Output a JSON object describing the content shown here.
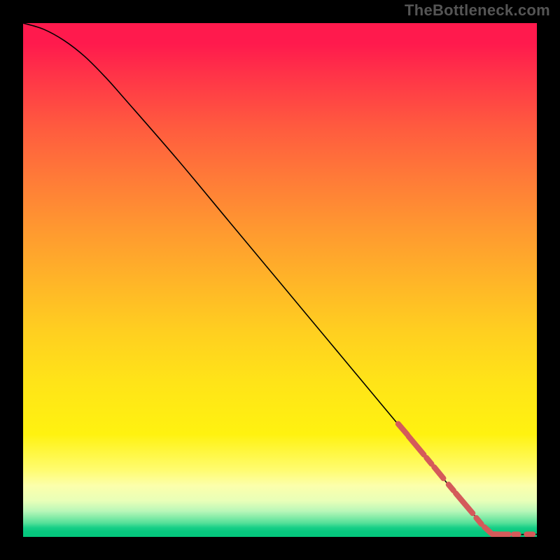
{
  "watermark": "TheBottleneck.com",
  "chart_data": {
    "type": "line",
    "title": "",
    "xlabel": "",
    "ylabel": "",
    "xlim": [
      0,
      100
    ],
    "ylim": [
      0,
      100
    ],
    "curve": {
      "name": "bottleneck-curve",
      "points": [
        {
          "x": 0,
          "y": 100
        },
        {
          "x": 4,
          "y": 98.8
        },
        {
          "x": 8,
          "y": 96.6
        },
        {
          "x": 12,
          "y": 93.5
        },
        {
          "x": 16,
          "y": 89.5
        },
        {
          "x": 20,
          "y": 85.0
        },
        {
          "x": 30,
          "y": 73.5
        },
        {
          "x": 40,
          "y": 61.5
        },
        {
          "x": 50,
          "y": 49.5
        },
        {
          "x": 60,
          "y": 37.5
        },
        {
          "x": 70,
          "y": 25.5
        },
        {
          "x": 75,
          "y": 19.5
        },
        {
          "x": 80,
          "y": 13.5
        },
        {
          "x": 84,
          "y": 8.7
        },
        {
          "x": 88,
          "y": 4.0
        },
        {
          "x": 90.5,
          "y": 1.2
        },
        {
          "x": 92,
          "y": 0.5
        },
        {
          "x": 100,
          "y": 0.5
        }
      ],
      "stroke": "#000000"
    },
    "highlight_segments": {
      "name": "curve-highlight-dashes",
      "color": "#d45a5a",
      "segments": [
        {
          "x0": 73.0,
          "y0": 22.0,
          "x1": 74.8,
          "y1": 19.9
        },
        {
          "x0": 75.0,
          "y0": 19.6,
          "x1": 78.0,
          "y1": 16.0
        },
        {
          "x0": 78.5,
          "y0": 15.4,
          "x1": 79.5,
          "y1": 14.2
        },
        {
          "x0": 80.0,
          "y0": 13.6,
          "x1": 81.8,
          "y1": 11.4
        },
        {
          "x0": 82.8,
          "y0": 10.2,
          "x1": 83.8,
          "y1": 9.0
        },
        {
          "x0": 84.2,
          "y0": 8.5,
          "x1": 87.5,
          "y1": 4.6
        },
        {
          "x0": 88.2,
          "y0": 3.7,
          "x1": 89.2,
          "y1": 2.5
        },
        {
          "x0": 89.8,
          "y0": 1.9,
          "x1": 91.0,
          "y1": 0.8
        },
        {
          "x0": 91.3,
          "y0": 0.55,
          "x1": 92.8,
          "y1": 0.5
        },
        {
          "x0": 93.0,
          "y0": 0.5,
          "x1": 94.5,
          "y1": 0.5
        },
        {
          "x0": 95.5,
          "y0": 0.5,
          "x1": 96.4,
          "y1": 0.5
        },
        {
          "x0": 98.0,
          "y0": 0.5,
          "x1": 99.2,
          "y1": 0.5
        }
      ]
    },
    "gradient": {
      "direction": "vertical",
      "stops": [
        {
          "pos": 0.0,
          "color": "#ff1a4d"
        },
        {
          "pos": 0.5,
          "color": "#ffcf20"
        },
        {
          "pos": 0.88,
          "color": "#fffc70"
        },
        {
          "pos": 0.95,
          "color": "#b8f7b8"
        },
        {
          "pos": 1.0,
          "color": "#04c67c"
        }
      ]
    }
  }
}
